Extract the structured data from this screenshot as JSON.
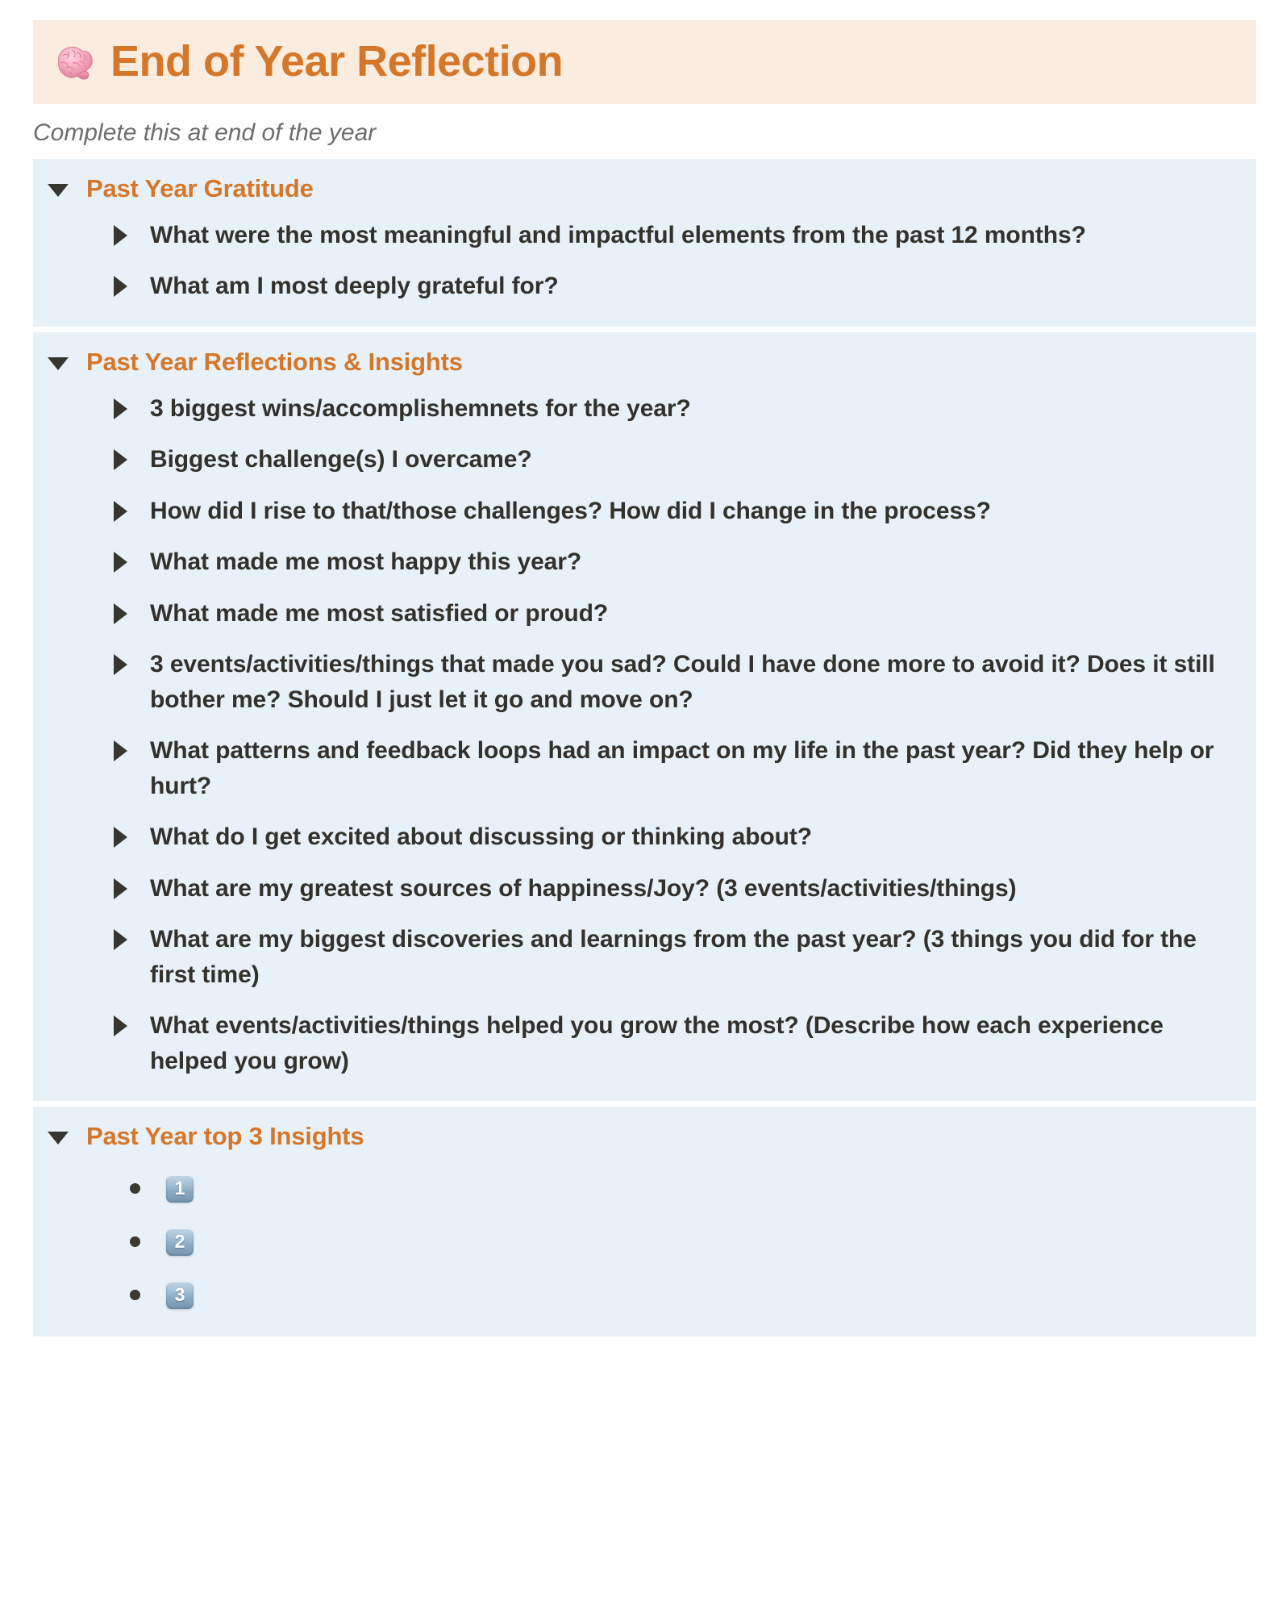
{
  "header": {
    "icon": "brain-icon",
    "title": "End of Year Reflection",
    "background_color": "#faecde",
    "title_color": "#d4772a"
  },
  "subtitle": "Complete this at end of the year",
  "colors": {
    "section_background": "#e9f1f8",
    "heading_orange": "#d4772a",
    "body_text": "#33312c",
    "page_background": "#ffffff"
  },
  "sections": [
    {
      "toggle_state": "expanded",
      "toggle_icon": "triangle-down-icon",
      "title": "Past Year Gratitude",
      "items": [
        "What were the most meaningful and impactful elements from the past 12 months?",
        "What am I most deeply grateful for?"
      ]
    },
    {
      "toggle_state": "expanded",
      "toggle_icon": "triangle-down-icon",
      "title": "Past Year Reflections & Insights",
      "items": [
        "3 biggest wins/accomplishemnets for the year?",
        "Biggest challenge(s) I overcame?",
        "How did I rise to that/those challenges? How did I change in the process?",
        "What made me most happy this year?",
        "What made me most satisfied or proud?",
        "3 events/activities/things that made you sad? Could I have done more to avoid it? Does it still bother me? Should I just let it go and move on?",
        "What patterns and feedback loops had an impact on my life in the past year? Did they help or hurt?",
        "What do I get excited about discussing or thinking about?",
        "What are my greatest sources of happiness/Joy? (3 events/activities/things)",
        "What are my biggest discoveries and learnings from the past year? (3 things you did for the first time)",
        "What events/activities/things helped you grow the most? (Describe how each experience helped you grow)"
      ]
    },
    {
      "toggle_state": "expanded",
      "toggle_icon": "triangle-down-icon",
      "title": "Past Year top 3 Insights",
      "bullets": [
        {
          "keycap": "1"
        },
        {
          "keycap": "2"
        },
        {
          "keycap": "3"
        }
      ]
    }
  ]
}
